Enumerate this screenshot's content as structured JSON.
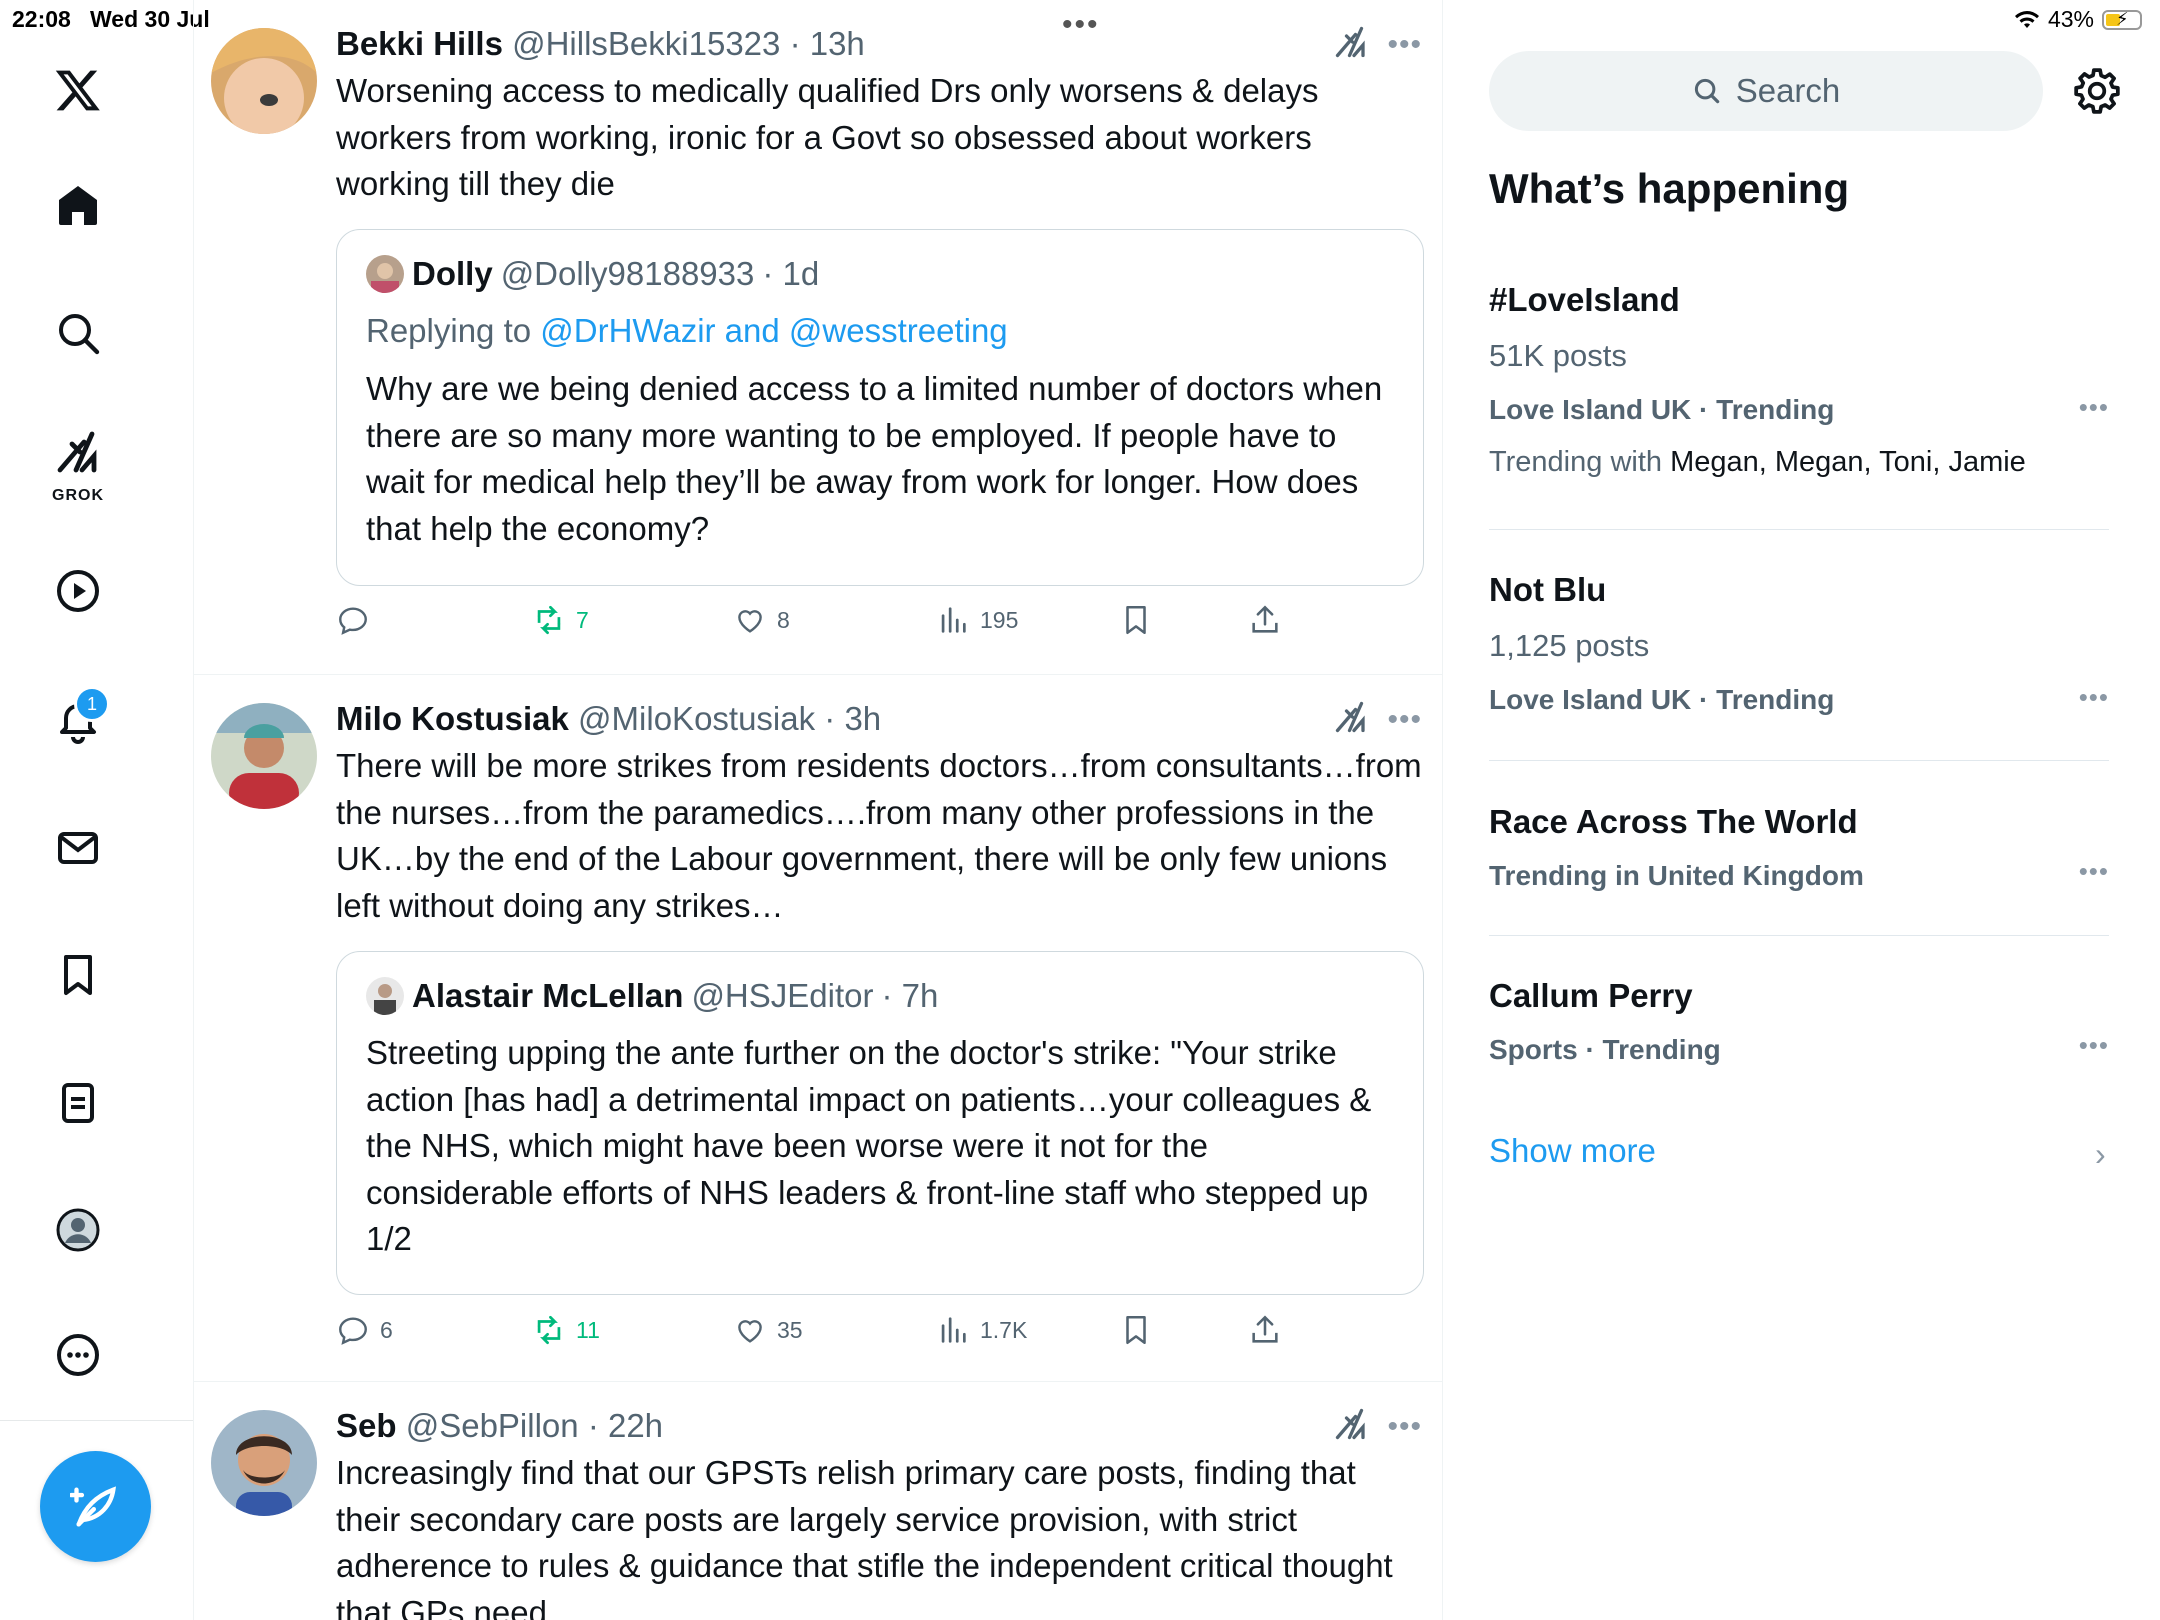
{
  "status_bar": {
    "time": "22:08",
    "date": "Wed 30 Jul",
    "battery": "43%"
  },
  "nav": {
    "items": [
      {
        "name": "x-logo",
        "icon": "x-logo-icon"
      },
      {
        "name": "home",
        "icon": "home-icon"
      },
      {
        "name": "explore",
        "icon": "search-icon"
      },
      {
        "name": "grok",
        "icon": "grok-icon",
        "label": "GROK"
      },
      {
        "name": "video",
        "icon": "play-icon"
      },
      {
        "name": "notifications",
        "icon": "bell-icon",
        "badge": "1"
      },
      {
        "name": "messages",
        "icon": "mail-icon"
      },
      {
        "name": "bookmarks",
        "icon": "bookmark-icon"
      },
      {
        "name": "lists",
        "icon": "list-icon"
      },
      {
        "name": "profile",
        "icon": "profile-icon"
      },
      {
        "name": "more",
        "icon": "more-icon"
      }
    ],
    "compose_icon": "compose-icon"
  },
  "tweets": [
    {
      "name": "Bekki Hills",
      "handle": "@HillsBekki15323",
      "time": "· 13h",
      "text": "Worsening access to medically qualified Drs only worsens & delays workers from working, ironic for a Govt so obsessed about workers working till they die",
      "quote": {
        "name": "Dolly",
        "handle": "@Dolly98188933",
        "time": "· 1d",
        "replying_prefix": "Replying to ",
        "replying_mentions": "@DrHWazir and @wesstreeting",
        "text": "Why are we being denied access to a limited number of doctors when there are so many more wanting to be employed.  If people have to wait for medical help they’ll be away from work for longer. How does that help the economy?"
      },
      "stats": {
        "replies": "",
        "reposts": "7",
        "likes": "8",
        "views": "195"
      }
    },
    {
      "name": "Milo Kostusiak",
      "handle": "@MiloKostusiak",
      "time": "· 3h",
      "text": "There will be more strikes from residents doctors…from consultants…from the nurses…from the paramedics….from many other professions in the UK…by the end of the Labour government, there will be only few unions left without doing any strikes…",
      "quote": {
        "name": "Alastair McLellan",
        "handle": "@HSJEditor",
        "time": "· 7h",
        "text": "Streeting upping the ante further on the doctor's strike: \"Your strike action [has had] a detrimental impact on patients…your colleagues & the NHS, which might have been worse were it not for the considerable efforts of NHS leaders & front-line staff who stepped up 1/2"
      },
      "stats": {
        "replies": "6",
        "reposts": "11",
        "likes": "35",
        "views": "1.7K"
      }
    },
    {
      "name": "Seb",
      "handle": "@SebPillon",
      "time": "· 22h",
      "text": "Increasingly find that our GPSTs relish primary care posts, finding that their secondary care posts are largely service provision, with strict adherence to rules & guidance that stifle the independent critical thought that GPs need"
    }
  ],
  "sidebar": {
    "search_placeholder": "Search",
    "heading": "What’s happening",
    "trends": [
      {
        "title": "#LoveIsland",
        "posts": "51K posts",
        "meta": "Love Island UK · Trending",
        "with_prefix": "Trending with ",
        "with_names": "Megan, Megan, Toni, Jamie"
      },
      {
        "title": "Not Blu",
        "posts": "1,125 posts",
        "meta": "Love Island UK · Trending"
      },
      {
        "title": "Race Across The World",
        "meta": "Trending in United Kingdom"
      },
      {
        "title": "Callum Perry",
        "meta": "Sports · Trending"
      }
    ],
    "show_more": "Show more",
    "more_dots": "•••"
  },
  "colors": {
    "accent": "#1d9bf0",
    "repost": "#00ba7c",
    "muted": "#536471",
    "text": "#0f1419"
  }
}
